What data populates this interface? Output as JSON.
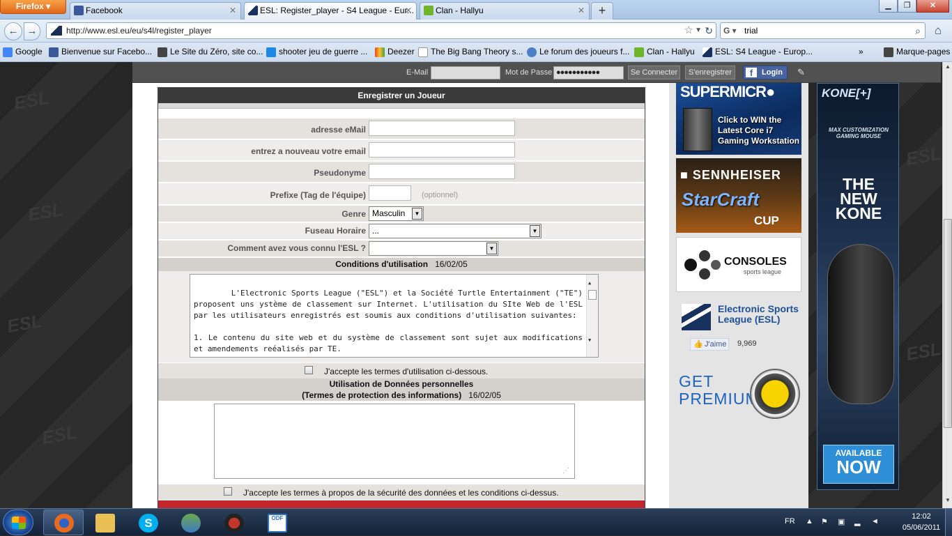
{
  "browser": {
    "app_button": "Firefox",
    "tabs": [
      {
        "label": "Facebook",
        "color": "#3b5998",
        "active": false
      },
      {
        "label": "ESL: Register_player - S4 League - Eur...",
        "color": "#17325f",
        "active": true
      },
      {
        "label": "Clan - Hallyu",
        "color": "#6fb52c",
        "active": false
      }
    ],
    "new_tab": "+",
    "url": "http://www.esl.eu/eu/s4l/register_player",
    "search_engine": "G",
    "search_value": "trial",
    "bookmarks": [
      {
        "label": "Google",
        "color": "#4285f4"
      },
      {
        "label": "Bienvenue sur Facebo...",
        "color": "#3b5998"
      },
      {
        "label": "Le Site du Zéro, site co...",
        "color": "#444444"
      },
      {
        "label": "shooter jeu de guerre ...",
        "color": "#1e88e5"
      },
      {
        "label": "Deezer",
        "color": "#e64a19"
      },
      {
        "label": "The Big Bang Theory s...",
        "color": "#ffffff"
      },
      {
        "label": "Le forum des joueurs f...",
        "color": "#4a80c8"
      },
      {
        "label": "Clan - Hallyu",
        "color": "#6fb52c"
      },
      {
        "label": "ESL: S4 League - Europ...",
        "color": "#17325f"
      }
    ],
    "bookmarks_more": "»",
    "bookmarks_menu": "Marque-pages"
  },
  "topstrip": {
    "email_label": "E-Mail",
    "email_value": "",
    "password_label": "Mot de Passe",
    "password_value": "●●●●●●●●●●●",
    "connect": "Se Connecter",
    "register": "S'enregistrer",
    "fb_login": "Login"
  },
  "form": {
    "title": "Enregistrer un Joueur",
    "fields": {
      "email": {
        "label": "adresse eMail",
        "value": ""
      },
      "email_confirm": {
        "label": "entrez a nouveau votre email",
        "value": ""
      },
      "nickname": {
        "label": "Pseudonyme",
        "value": ""
      },
      "prefix": {
        "label": "Prefixe (Tag de l'équipe)",
        "value": "",
        "hint": "(optionnel)"
      },
      "gender": {
        "label": "Genre",
        "value": "Masculin"
      },
      "timezone": {
        "label": "Fuseau Horaire",
        "value": "..."
      },
      "referral": {
        "label": "Comment avez vous connu l'ESL ?",
        "value": ""
      }
    },
    "terms": {
      "title": "Conditions d'utilisation",
      "date": "16/02/05",
      "text": "L'Electronic Sports League (\"ESL\") et la Société Turtle Entertainment (\"TE\") proposent uns ystème de classement sur Internet. L'utilisation du SIte Web de l'ESL par les utilisateurs enregistrés est soumis aux conditions d'utilisation suivantes:\n\n1. Le contenu du site web et du système de classement sont sujet aux modifications et amendements reéalisés par TE.",
      "accept": "J'accepte les termes d'utilisation ci-dessous."
    },
    "privacy": {
      "title_line1": "Utilisation de Données personnelles",
      "title_line2": "(Termes de protection des informations)",
      "date": "16/02/05",
      "text": "",
      "accept": "J'accepte les termes à propos de la sécurité des données et les conditions ci-dessus."
    }
  },
  "sidebar": {
    "ad_supermicro": {
      "brand": "SUPERMICR●",
      "text": "Click to WIN the Latest Core i7 Gaming Workstation"
    },
    "ad_sennheiser": {
      "brand": "■ SENNHEISER",
      "game": "StarCraft",
      "cup": "CUP"
    },
    "ad_consoles": {
      "title": "CONSOLES",
      "subtitle": "sports league"
    },
    "fb_page": {
      "name": "Electronic Sports League (ESL)",
      "like": "J'aime",
      "count": "9,969"
    },
    "premium": {
      "line1": "GET",
      "line2": "PREMIUM"
    }
  },
  "right_ad": {
    "brand": "KONE[+]",
    "tagline": "MAX CUSTOMIZATION GAMING MOUSE",
    "headline": "THE NEW KONE",
    "cta_top": "AVAILABLE",
    "cta_bottom": "NOW"
  },
  "taskbar": {
    "apps": [
      {
        "name": "firefox",
        "color": "#e66a1f"
      },
      {
        "name": "explorer",
        "color": "#e8c054"
      },
      {
        "name": "skype",
        "color": "#00aff0"
      },
      {
        "name": "network",
        "color": "#6aa84f"
      },
      {
        "name": "s4league",
        "color": "#c0392b"
      },
      {
        "name": "odf-document",
        "color": "#2a73c9"
      }
    ],
    "language": "FR",
    "time": "12:02",
    "date": "05/06/2011"
  }
}
